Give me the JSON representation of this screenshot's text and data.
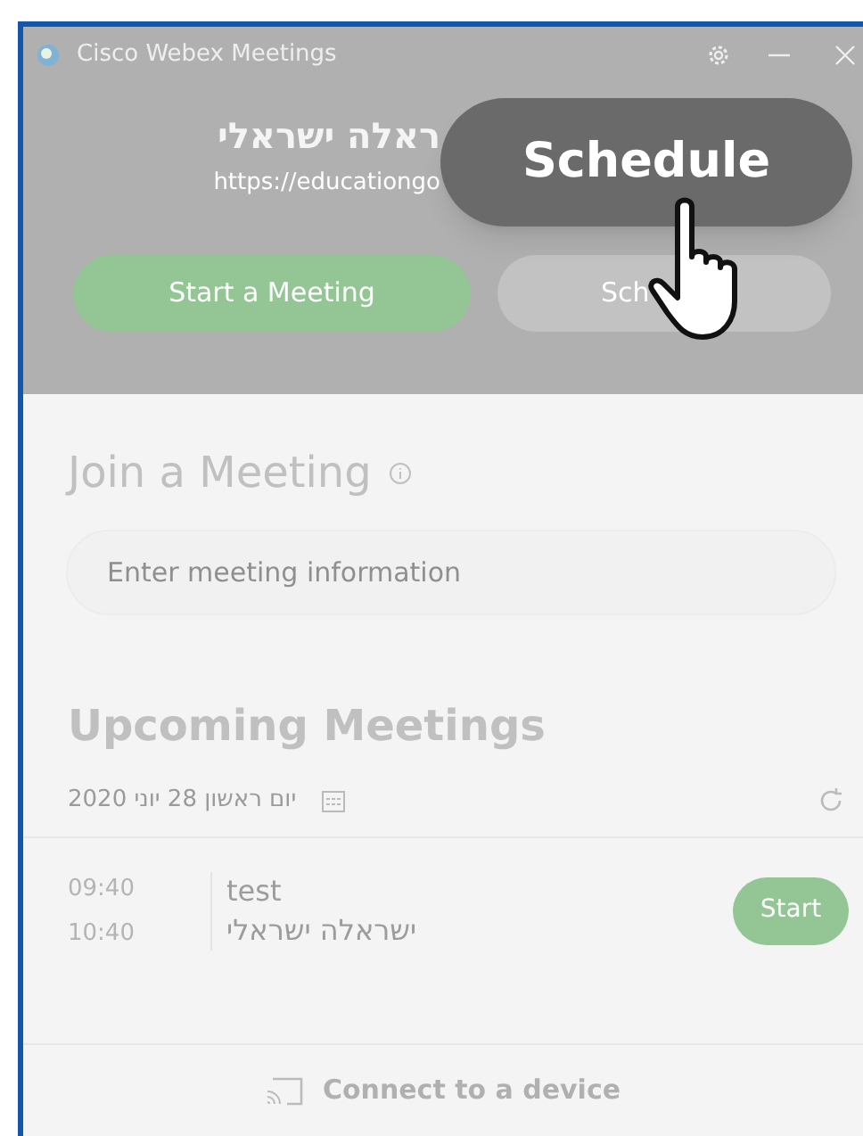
{
  "window": {
    "title": "Cisco Webex Meetings"
  },
  "header": {
    "user_name": "ראלה ישראלי",
    "site_url": "https://educationgo"
  },
  "actions": [
    {
      "label": "Start a Meeting",
      "kind": "primary"
    },
    {
      "label": "Sch",
      "kind": "secondary"
    }
  ],
  "callout": {
    "label": "Schedule"
  },
  "join": {
    "title": "Join a Meeting",
    "placeholder": "Enter meeting information"
  },
  "upcoming": {
    "title": "Upcoming Meetings",
    "date": "יום ראשון 28 יוני 2020",
    "meetings": [
      {
        "start": "09:40",
        "end": "10:40",
        "title": "test",
        "host": "ישראלה ישראלי",
        "action": "Start"
      }
    ]
  },
  "footer": {
    "label": "Connect to a device"
  }
}
